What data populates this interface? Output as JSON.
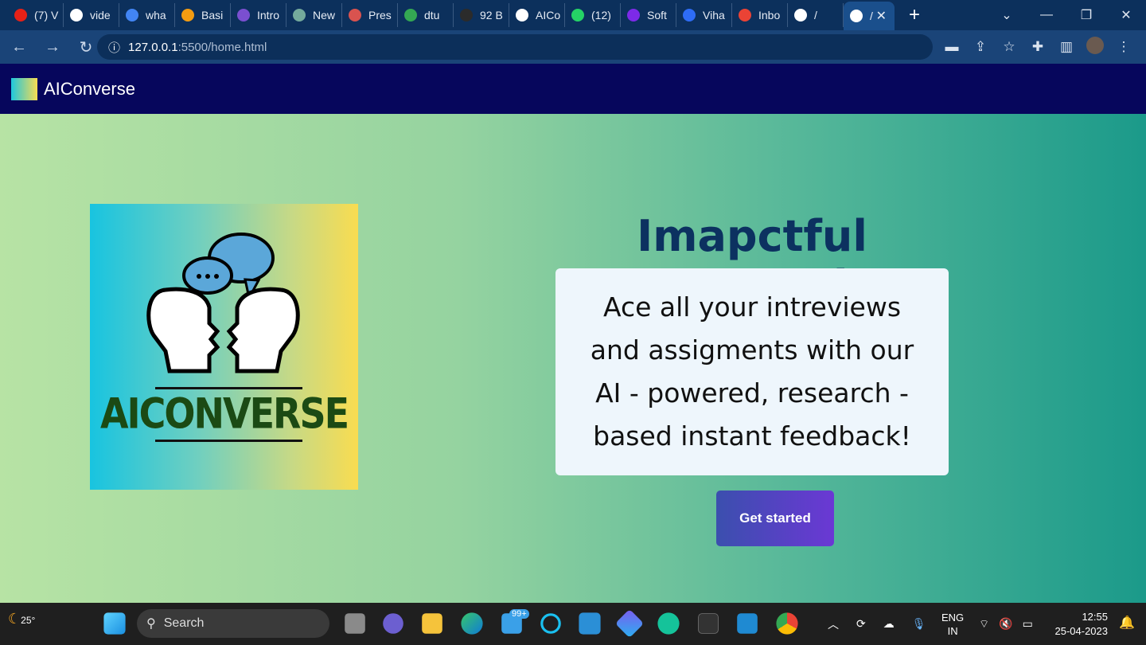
{
  "browser": {
    "tabs": [
      {
        "label": "(7) V",
        "color": "#e62117"
      },
      {
        "label": "vide",
        "color": "#ffffff"
      },
      {
        "label": "wha",
        "color": "#4285f4"
      },
      {
        "label": "Basi",
        "color": "#f39c12"
      },
      {
        "label": "Intro",
        "color": "#7a4fd0"
      },
      {
        "label": "New",
        "color": "#74aa9c"
      },
      {
        "label": "Pres",
        "color": "#d9534f"
      },
      {
        "label": "dtu",
        "color": "#34a853"
      },
      {
        "label": "92 B",
        "color": "#2b2b2b"
      },
      {
        "label": "AICo",
        "color": "#ffffff"
      },
      {
        "label": "(12)",
        "color": "#25d366"
      },
      {
        "label": "Soft",
        "color": "#7d2ae8"
      },
      {
        "label": "Viha",
        "color": "#2e6cf6"
      },
      {
        "label": "Inbo",
        "color": "#ea4335"
      },
      {
        "label": "/",
        "color": "#ffffff"
      }
    ],
    "active_tab": {
      "label": "/",
      "close": "✕"
    },
    "new_tab": "+",
    "url_host": "127.0.0.1",
    "url_rest": ":5500/home.html"
  },
  "navbar": {
    "brand": "AIConverse"
  },
  "hero": {
    "logo_wordmark": "AICONVERSE",
    "title": "Imapctful Presentation",
    "description": "Ace all your intreviews and assigments with our AI - powered, research - based instant feedback!",
    "cta": "Get started",
    "colors": {
      "title": "#0c3160",
      "cta_start": "#3b4fae",
      "cta_end": "#6b38d4",
      "nav": "#06065c"
    }
  },
  "taskbar": {
    "weather": "25°",
    "search": "Search",
    "mail_badge": "99+",
    "lang_1": "ENG",
    "lang_2": "IN",
    "time": "12:55",
    "date": "25-04-2023"
  }
}
